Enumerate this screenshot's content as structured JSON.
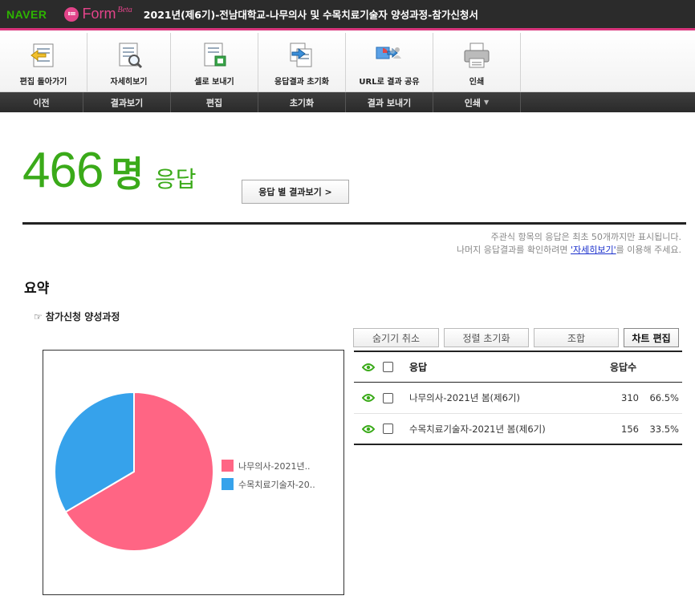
{
  "header": {
    "naver": "NAVER",
    "form": "Form",
    "beta": "Beta",
    "title": "2021년(제6기)-전남대학교-나무의사 및 수목치료기술자 양성과정-참가신청서"
  },
  "toolbar": {
    "tools": [
      {
        "label": "편집 돌아가기",
        "icon": "back-edit-icon"
      },
      {
        "label": "자세히보기",
        "icon": "detail-view-icon"
      },
      {
        "label": "셀로 보내기",
        "icon": "send-to-cell-icon"
      },
      {
        "label": "응답결과 초기화",
        "icon": "reset-results-icon"
      },
      {
        "label": "URL로 결과 공유",
        "icon": "share-url-icon"
      },
      {
        "label": "인쇄",
        "icon": "printer-icon"
      }
    ],
    "groups": [
      "이전",
      "결과보기",
      "편집",
      "초기화",
      "결과 보내기",
      "인쇄"
    ]
  },
  "summary_head": {
    "count": "466",
    "unit": "명",
    "label": "응답",
    "view_button": "응답 별 결과보기 >"
  },
  "notice": {
    "line1": "주관식 항목의 응답은 최초 50개까지만 표시됩니다.",
    "line2_pre": "나머지 응답결과를 확인하려면 ",
    "line2_link": "'자세히보기'",
    "line2_post": "를 이용해 주세요."
  },
  "section": {
    "title": "요약",
    "question": "☞ 참가신청 양성과정"
  },
  "actions": {
    "unhide": "숨기기 취소",
    "reset_sort": "정렬 초기화",
    "combine": "조합",
    "edit_chart": "차트 편집"
  },
  "table": {
    "col_answer": "응답",
    "col_count": "응답수",
    "rows": [
      {
        "label": "나무의사-2021년 봄(제6기)",
        "count": "310",
        "pct": "66.5%"
      },
      {
        "label": "수목치료기술자-2021년 봄(제6기)",
        "count": "156",
        "pct": "33.5%"
      }
    ]
  },
  "chart_data": {
    "type": "pie",
    "categories": [
      "나무의사-2021년..",
      "수목치료기술자-20.."
    ],
    "values": [
      310,
      156
    ],
    "colors": [
      "#ff6584",
      "#36a2eb"
    ],
    "legend_position": "right"
  },
  "colors": {
    "accent_green": "#3aaa19",
    "brand_pink": "#e3448a",
    "eye_green": "#3aaa19"
  }
}
